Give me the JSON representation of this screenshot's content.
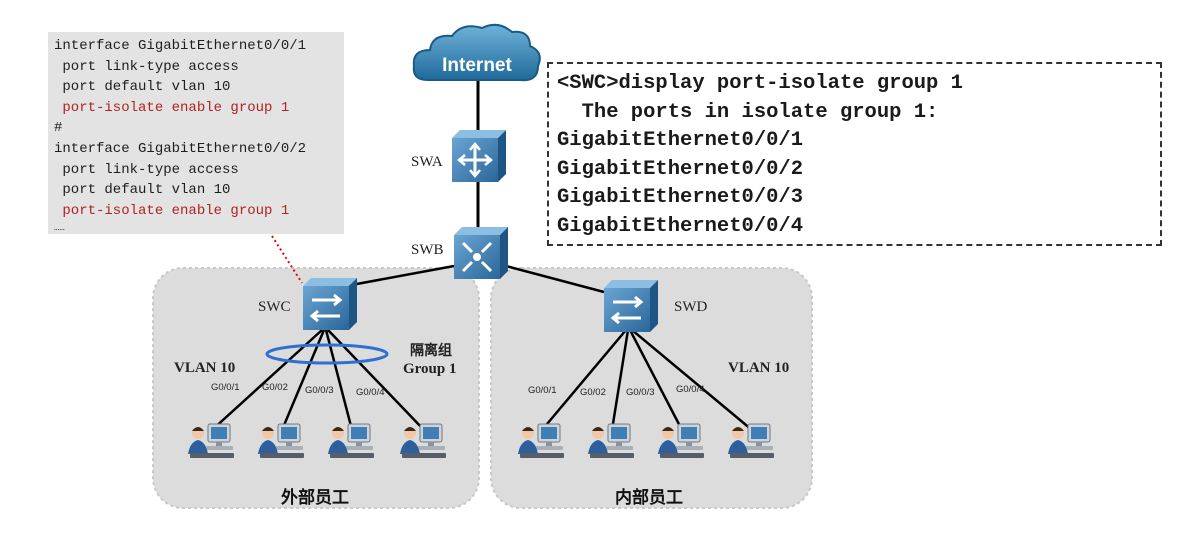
{
  "config": {
    "lines": [
      {
        "text": "interface GigabitEthernet0/0/1",
        "highlight": false
      },
      {
        "text": " port link-type access",
        "highlight": false
      },
      {
        "text": " port default vlan 10",
        "highlight": false
      },
      {
        "text": " port-isolate enable group 1",
        "highlight": true
      },
      {
        "text": "#",
        "highlight": false
      },
      {
        "text": "interface GigabitEthernet0/0/2",
        "highlight": false
      },
      {
        "text": " port link-type access",
        "highlight": false
      },
      {
        "text": " port default vlan 10",
        "highlight": false
      },
      {
        "text": " port-isolate enable group 1",
        "highlight": true
      }
    ],
    "ellipsis": "……"
  },
  "console": {
    "lines": [
      "<SWC>display port-isolate group 1",
      "  The ports in isolate group 1:",
      "GigabitEthernet0/0/1",
      "GigabitEthernet0/0/2",
      "GigabitEthernet0/0/3",
      "GigabitEthernet0/0/4"
    ]
  },
  "cloud_label": "Internet",
  "devices": {
    "swa": "SWA",
    "swb": "SWB",
    "swc": "SWC",
    "swd": "SWD"
  },
  "left_zone": {
    "vlan": "VLAN 10",
    "group_cn": "隔离组",
    "group_en": "Group 1",
    "ports": [
      "G0/0/1",
      "G0/02",
      "G0/0/3",
      "G0/0/4"
    ],
    "title": "外部员工"
  },
  "right_zone": {
    "vlan": "VLAN 10",
    "ports": [
      "G0/0/1",
      "G0/02",
      "G0/0/3",
      "G0/0/4"
    ],
    "title": "内部员工"
  },
  "colors": {
    "zone_fill": "#dcdcdc",
    "zone_border": "#c8c8c8",
    "config_bg": "#e3e3e3",
    "highlight_text": "#b22222",
    "isolation_ring": "#2f6fd1",
    "cloud": "#2f7fb0",
    "switch_face": "#3d7fb5",
    "dotted_connector": "#cc1111"
  }
}
